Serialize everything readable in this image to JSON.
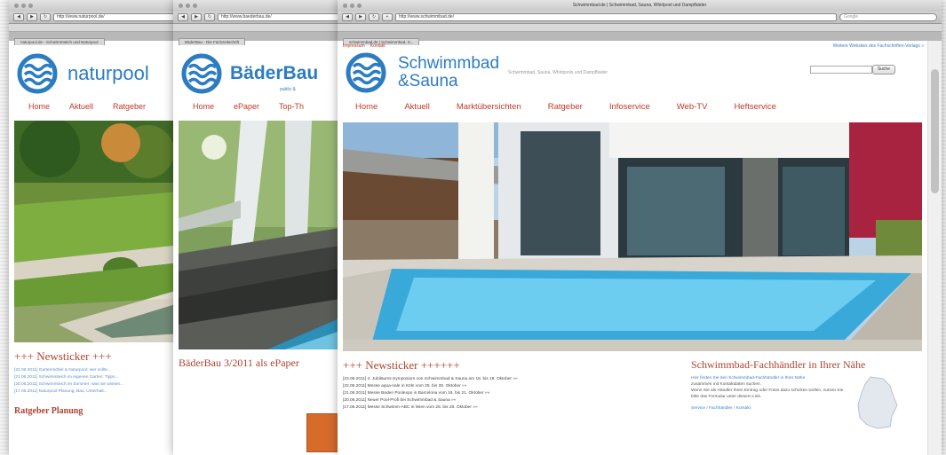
{
  "windows": [
    {
      "url": "http://www.naturpool.de/",
      "tab_title": "naturpool.de - Schwimmteich und Naturpool",
      "logo_text": "naturpool",
      "menu": [
        "Home",
        "Aktuell",
        "Ratgeber"
      ],
      "ticker_title": "+++ Newsticker +++",
      "ticker_lines": [
        "[22.06.2011] Gartenmöbel & Naturpool: wer sollte...",
        "[21.06.2011] Schwimmteich im eigenen Garten: Tipps...",
        "[20.06.2011] Schwimmteich im Sommer: was sie wissen...",
        "[17.06.2011] Naturpool Planung, Bau, Unterhalt..."
      ],
      "section_title": "Ratgeber Planung"
    },
    {
      "url": "http://www.baederbau.de/",
      "tab_title": "BäderBau - Die Fachzeitschrift",
      "logo_text": "BäderBau",
      "logo_sub": "public &",
      "menu": [
        "Home",
        "ePaper",
        "Top-Th"
      ],
      "ticker_title": "BäderBau 3/2011 als ePaper"
    },
    {
      "title": "Schwimmbad.de | Schwimmbad, Sauna, Whirlpool und Dampfbäder",
      "url": "http://www.schwimmbad.de/",
      "tab_title": "schwimmbad.de | Schwimmbad, S...",
      "search_placeholder": "Google",
      "toplinks": [
        "Impressum",
        "Kontakt"
      ],
      "partner_link": "Weitere Websites des Fachschriften-Verlags »",
      "logo_line1": "Schwimmbad",
      "logo_line2": "&Sauna",
      "tagline": "Schwimmbad, Sauna, Whirlpools und Dampfbäder",
      "header_search_button": "Suche",
      "menu": [
        "Home",
        "Aktuell",
        "Marktübersichten",
        "Ratgeber",
        "Infoservice",
        "Web-TV",
        "Heftservice"
      ],
      "social": [
        "twitter-icon",
        "facebook-icon",
        "rss-icon"
      ],
      "ticker_title": "+++ Newsticker ++++++",
      "ticker_lines": [
        "[23.06.2011] 4. Jubiläums-Symposium von Schwimmbad & Sauna am 18. bis 19. Oktober »»",
        "[22.06.2011] Messe aqua-nale in Köln vom 25. bis 28. Oktober »»",
        "[21.06.2011] Messe Baden Poolexpo in Barcelona vom 18. bis 21. Oktober »»",
        "[20.06.2011] Neuer Pool-Profi bei Schwimmbad & Sauna »»",
        "[17.06.2011] Messe Schwimm-ABC in Wien vom 25. bis 28. Oktober »»"
      ],
      "side_title": "Schwimmbad-Fachhändler in Ihrer Nähe",
      "side_link": "Hier finden Sie den Schwimmbad-Fachhändler in Ihrer Nähe",
      "side_text_1": "zusammen mit Kontaktdaten suchen.",
      "side_text_2": "Wenn Sie als Händler Ihren Eintrag oder Fotos dazu schicken wollen, nutzen Sie bitte das Formular unter diesem Link.",
      "side_more": "Service / Fachhändler / Kontakt"
    }
  ],
  "colors": {
    "brand_blue": "#2c7cc2",
    "menu_red": "#c0392b",
    "heading_red": "#b0432e"
  }
}
